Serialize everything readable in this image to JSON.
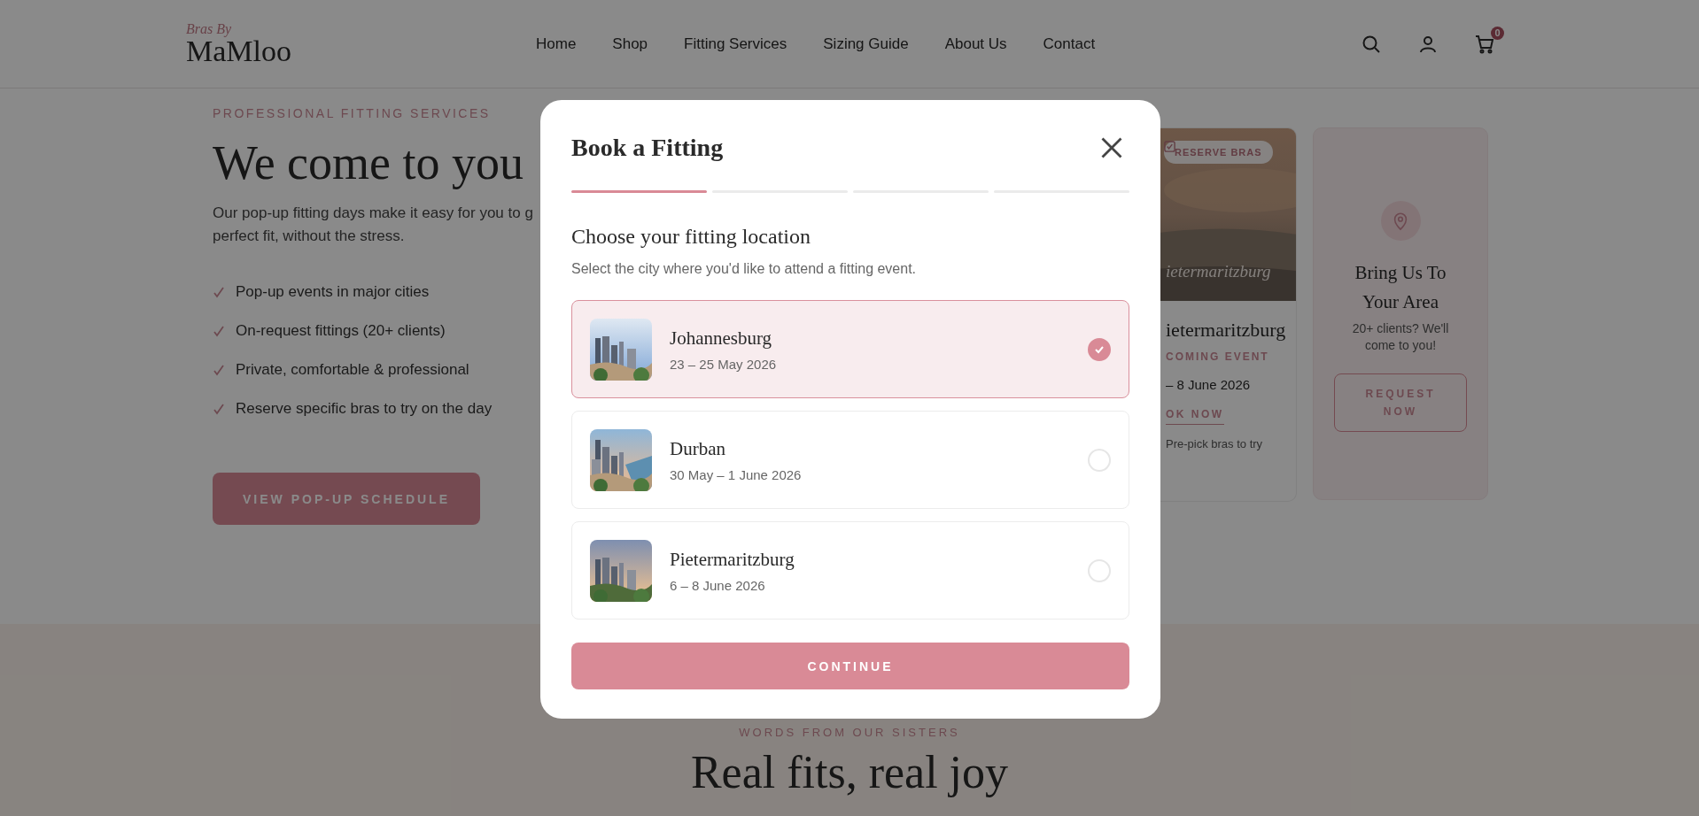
{
  "header": {
    "logo_tagline": "Bras By",
    "logo": "MaMloo",
    "nav": [
      "Home",
      "Shop",
      "Fitting Services",
      "Sizing Guide",
      "About Us",
      "Contact"
    ],
    "cart_count": "0"
  },
  "hero": {
    "eyebrow": "PROFESSIONAL FITTING SERVICES",
    "title": "We come to you",
    "intro_lines": [
      "Our pop-up fitting days make it easy for you to g",
      "perfect fit, without the stress."
    ],
    "features": [
      "Pop-up events in major cities",
      "On-request fittings (20+ clients)",
      "Private, comfortable & professional",
      "Reserve specific bras to try on the day"
    ],
    "button": "VIEW POP-UP SCHEDULE"
  },
  "event_card": {
    "badge": "RESERVE BRAS",
    "image_caption": "ietermaritzburg",
    "title": "ietermaritzburg",
    "eyebrow": "COMING EVENT",
    "dates": "– 8 June 2026",
    "link": "OK NOW",
    "note": "Pre-pick bras to try"
  },
  "request_card": {
    "title": "Bring Us To Your Area",
    "text": "20+ clients? We'll come to you!",
    "button": "REQUEST NOW"
  },
  "testimonials": {
    "eyebrow": "WORDS FROM OUR SISTERS",
    "title": "Real fits, real joy"
  },
  "modal": {
    "title": "Book a Fitting",
    "steps": [
      {
        "done": true
      },
      {
        "done": false
      },
      {
        "done": false
      },
      {
        "done": false
      }
    ],
    "heading": "Choose your fitting location",
    "description": "Select the city where you'd like to attend a fitting event.",
    "locations": [
      {
        "name": "Johannesburg",
        "dates": "23 – 25 May 2026",
        "selected": true
      },
      {
        "name": "Durban",
        "dates": "30 May – 1 June 2026",
        "selected": false
      },
      {
        "name": "Pietermaritzburg",
        "dates": "6 – 8 June 2026",
        "selected": false
      }
    ],
    "button": "CONTINUE"
  }
}
